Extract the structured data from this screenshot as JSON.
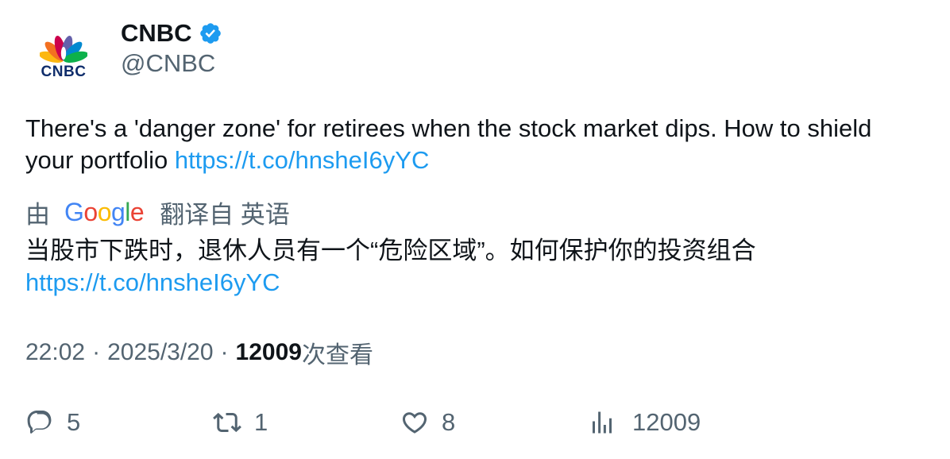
{
  "author": {
    "display_name": "CNBC",
    "handle": "@CNBC",
    "avatar_logo_text": "CNBC",
    "verified_icon": "verified-badge-icon",
    "verified_color": "#1d9bf0"
  },
  "tweet": {
    "text": "There's a 'danger zone' for retirees when the stock market dips. How to shield your portfolio ",
    "link": "https://t.co/hnsheI6yYC"
  },
  "translation": {
    "by_label": "由",
    "provider": "Google",
    "from_label": "翻译自 英语",
    "text": "当股市下跌时，退休人员有一个“危险区域”。如何保护你的投资组合",
    "link": "https://t.co/hnsheI6yYC"
  },
  "meta": {
    "time": "22:02",
    "separator": "·",
    "date": "2025/3/20",
    "views_count": "12009",
    "views_label": "次查看"
  },
  "actions": {
    "replies": {
      "icon": "reply-icon",
      "count": "5"
    },
    "retweets": {
      "icon": "retweet-icon",
      "count": "1"
    },
    "likes": {
      "icon": "heart-icon",
      "count": "8"
    },
    "views": {
      "icon": "analytics-icon",
      "count": "12009"
    }
  },
  "colors": {
    "text_primary": "#0f1419",
    "text_secondary": "#536471",
    "link": "#1d9bf0",
    "google_blue": "#4285f4",
    "google_red": "#ea4335",
    "google_yellow": "#fbbc05",
    "google_green": "#34a853"
  }
}
